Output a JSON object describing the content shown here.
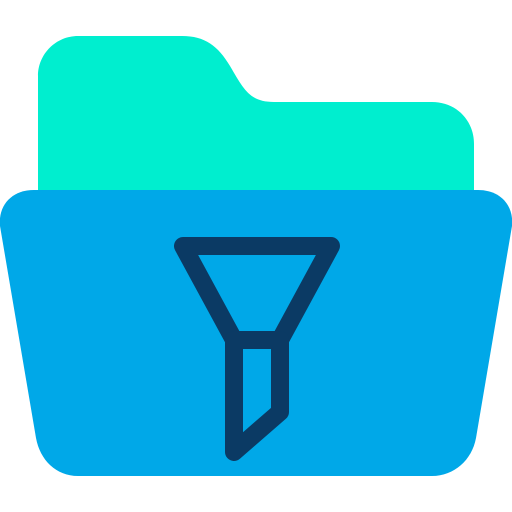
{
  "icon": {
    "name": "folder-filter-icon",
    "parts": {
      "folder_back": "folder-back-icon",
      "folder_front": "folder-front-icon",
      "funnel": "filter-funnel-icon"
    },
    "colors": {
      "background": "#FFFFFF",
      "folder_back": "#00EECF",
      "folder_front": "#00A8E8",
      "funnel_stroke": "#0B3A64"
    }
  }
}
